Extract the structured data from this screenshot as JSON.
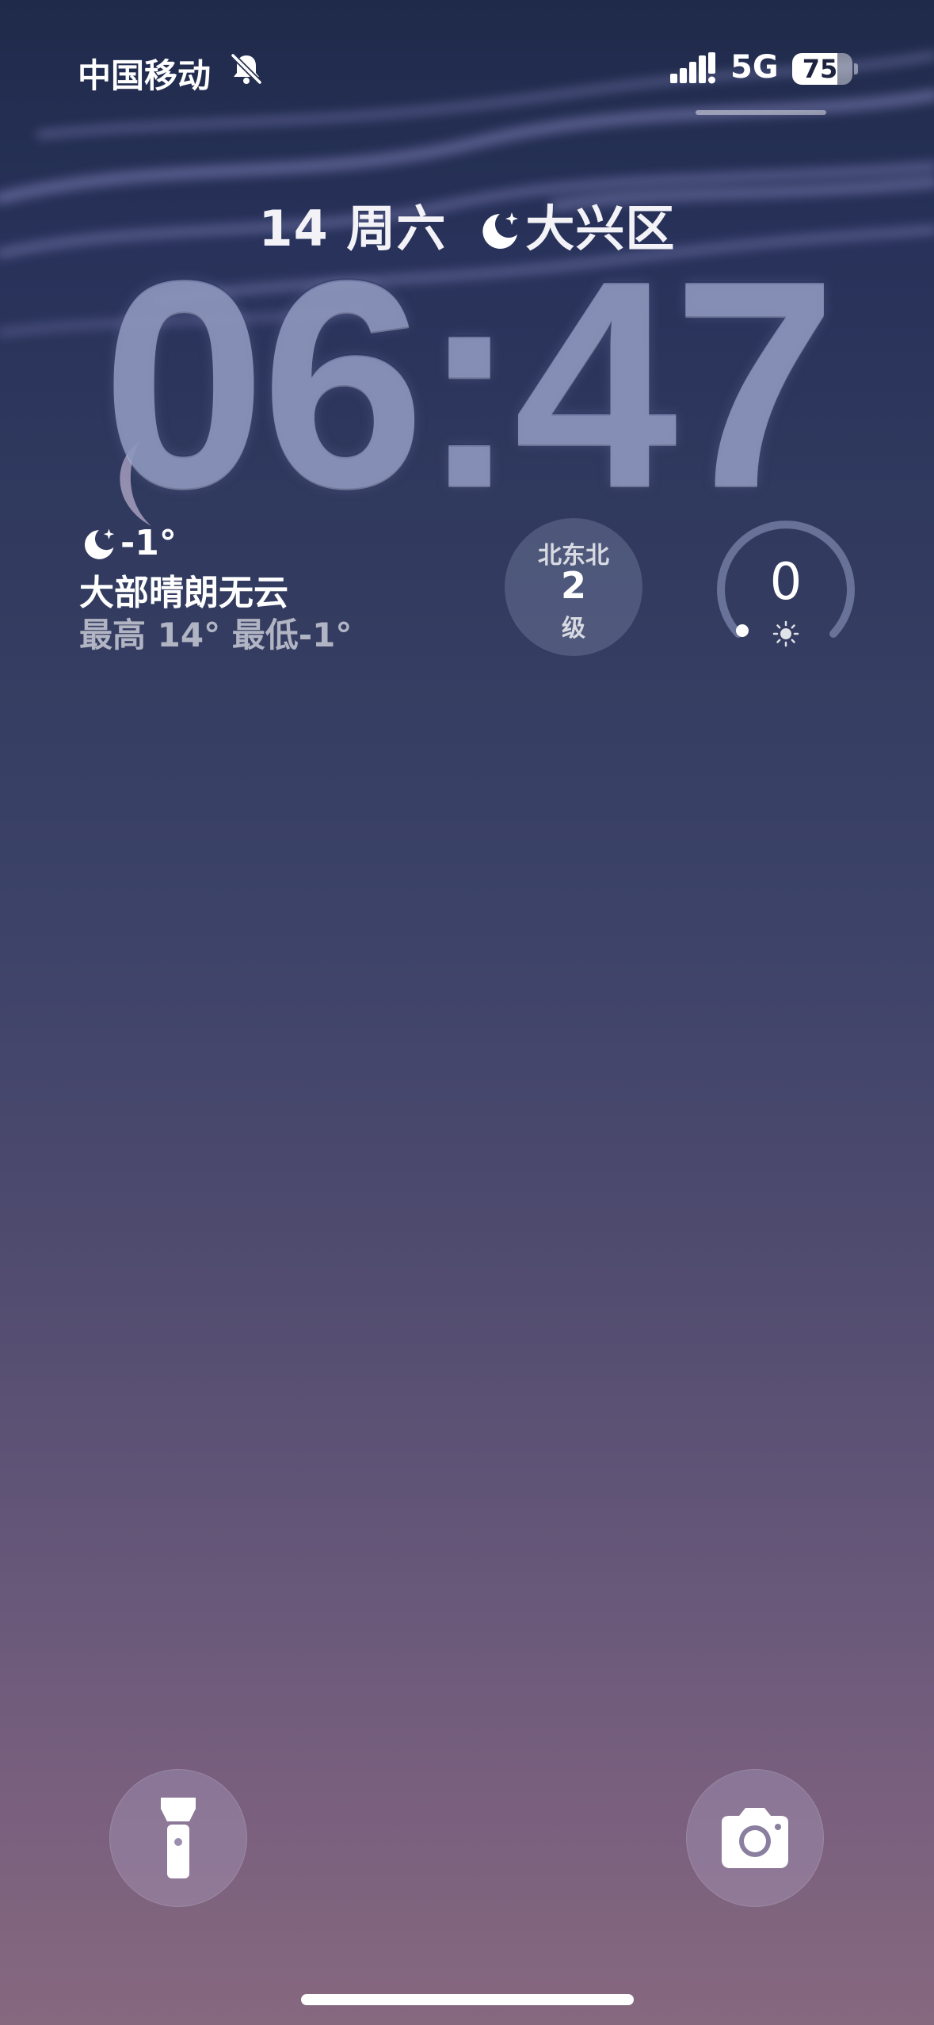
{
  "status_bar": {
    "carrier": "中国移动",
    "network": "5G",
    "battery_percent": 75,
    "battery_label": "75"
  },
  "lock_screen": {
    "date_text": "14 周六",
    "location": "大兴区",
    "time": "06:47"
  },
  "weather_widget": {
    "temperature": "-1°",
    "condition": "大部晴朗无云",
    "range": "最高 14° 最低-1°"
  },
  "wind_widget": {
    "direction": "北东北",
    "level": "2",
    "unit": "级"
  },
  "uv_widget": {
    "value": "0"
  },
  "icons": [
    "bell-slash-icon",
    "cellular-signal-icon",
    "moon-stars-icon",
    "sun-icon",
    "flashlight-icon",
    "camera-icon"
  ],
  "colors": {
    "background_top": "#1f2a4a",
    "background_bottom": "#86687f",
    "clock": "#8c96be"
  }
}
